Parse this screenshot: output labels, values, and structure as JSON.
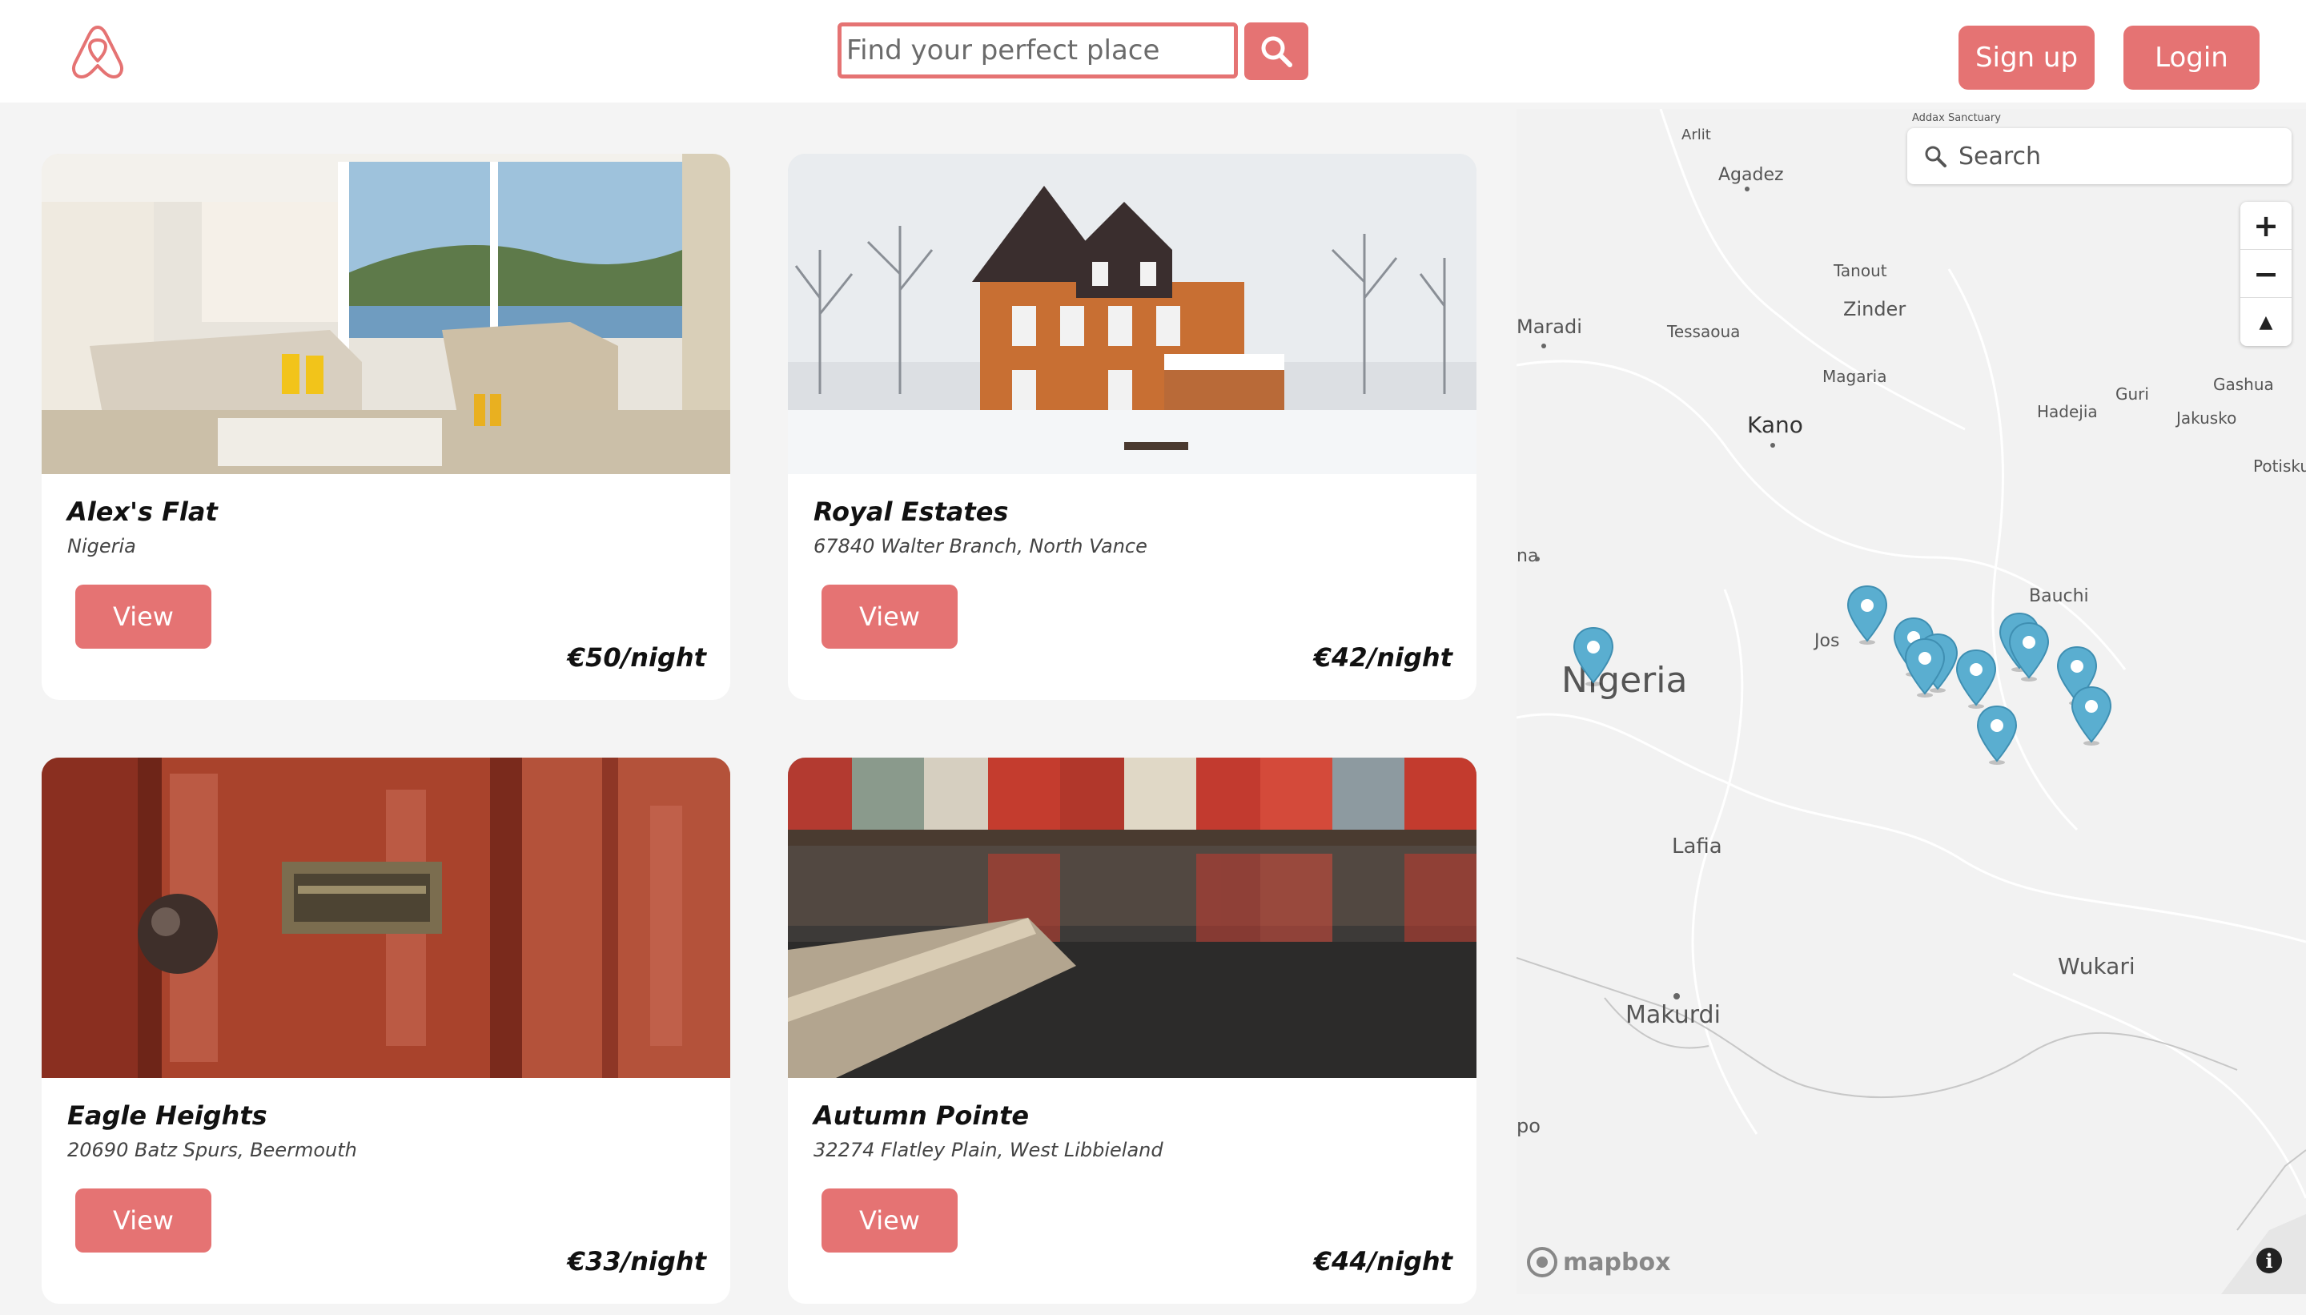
{
  "header": {
    "search_placeholder": "Find your perfect place",
    "signup_label": "Sign up",
    "login_label": "Login"
  },
  "listings": [
    {
      "title": "Alex's Flat",
      "address": "Nigeria",
      "view_label": "View",
      "price": "€50/night"
    },
    {
      "title": "Royal Estates",
      "address": "67840 Walter Branch, North Vance",
      "view_label": "View",
      "price": "€42/night"
    },
    {
      "title": "Eagle Heights",
      "address": "20690 Batz Spurs, Beermouth",
      "view_label": "View",
      "price": "€33/night"
    },
    {
      "title": "Autumn Pointe",
      "address": "32274 Flatley Plain, West Libbieland",
      "view_label": "View",
      "price": "€44/night"
    }
  ],
  "map": {
    "search_placeholder": "Search",
    "zoom_in": "+",
    "zoom_out": "−",
    "compass": "▲",
    "attribution_logo": "mapbox",
    "info": "i",
    "labels": {
      "arlit": "Arlit",
      "addax": "Addax Sanctuary",
      "agadez": "Agadez",
      "tanout": "Tanout",
      "zinder": "Zinder",
      "maradi": "Maradi",
      "tessaoua": "Tessaoua",
      "magaria": "Magaria",
      "guri": "Guri",
      "gashua": "Gashua",
      "hadejia": "Hadejia",
      "jakusko": "Jakusko",
      "kano": "Kano",
      "potiskum": "Potisku",
      "bauchi": "Bauchi",
      "jos": "Jos",
      "nigeria": "Nigeria",
      "lafia": "Lafia",
      "wukari": "Wukari",
      "makurdi": "Makurdi",
      "po": "po",
      "na": "na"
    }
  },
  "colors": {
    "accent": "#e57373",
    "marker": "#5aaed0",
    "background": "#f4f4f4"
  }
}
